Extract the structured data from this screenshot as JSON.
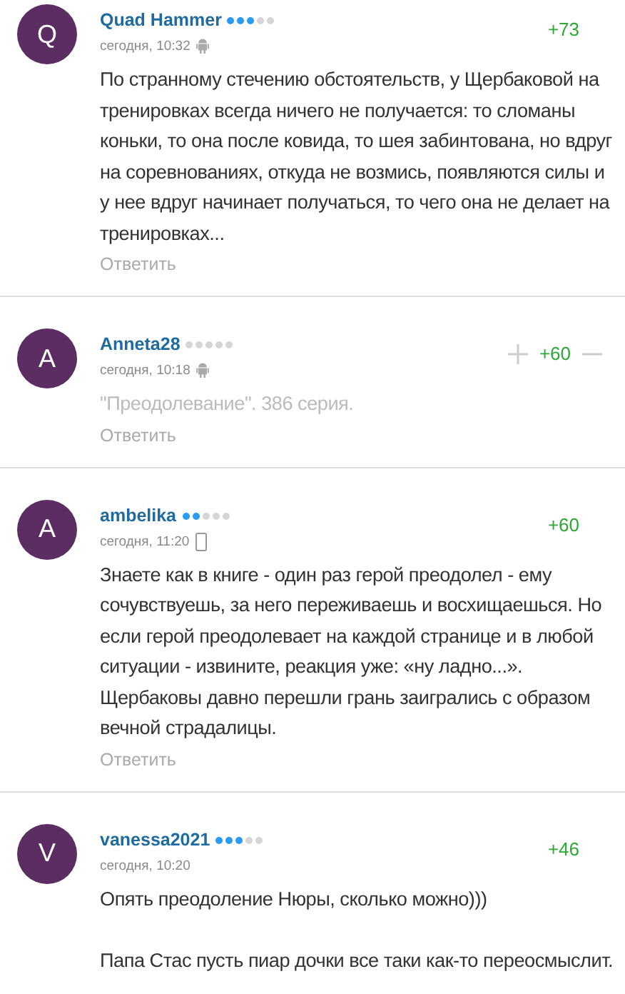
{
  "comments": [
    {
      "avatar_letter": "Q",
      "username": "Quad Hammer",
      "stars": 3,
      "time": "сегодня, 10:32",
      "android_icon": true,
      "vote_buttons": false,
      "score": "+73",
      "muted": false,
      "text": "По странному стечению обстоятельств, у Щербаковой на тренировках всегда ничего не получается: то сломаны коньки, то она после ковида, то шея забинтована, но вдруг на соревнованиях, откуда не возмись, появляются силы и у нее вдруг начинает получаться, то чего она не делает на тренировках...",
      "reply": "Ответить"
    },
    {
      "avatar_letter": "A",
      "username": "Anneta28",
      "stars": 0,
      "time": "сегодня, 10:18",
      "android_icon": true,
      "vote_buttons": true,
      "score": "+60",
      "muted": true,
      "text": "\"Преодолевание\". 386 серия.",
      "reply": "Ответить"
    },
    {
      "avatar_letter": "A",
      "username": "ambelika",
      "stars": 2,
      "time": "сегодня, 11:20",
      "phone_icon": true,
      "vote_buttons": false,
      "score": "+60",
      "muted": false,
      "text": "Знаете как в книге - один раз герой преодолел - ему сочувствуешь, за него переживаешь и восхищаешься. Но если герой преодолевает на каждой странице и в любой ситуации - извините, реакция уже: «ну ладно...». Щербаковы давно перешли грань заигрались с образом вечной страдалицы.",
      "reply": "Ответить"
    },
    {
      "avatar_letter": "V",
      "username": "vanessa2021",
      "stars": 3,
      "time": "сегодня, 10:20",
      "vote_buttons": false,
      "score": "+46",
      "muted": false,
      "text": "Опять преодоление Нюры, сколько можно)))\n\nПапа Стас пусть пиар дочки все таки как-то переосмыслит."
    }
  ]
}
